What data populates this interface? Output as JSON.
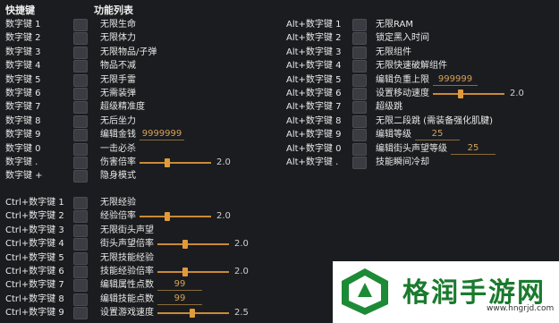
{
  "header": {
    "col_key": "快捷键",
    "col_func": "功能列表"
  },
  "left": [
    {
      "key": "数字键 1",
      "label": "无限生命"
    },
    {
      "key": "数字键 2",
      "label": "无限体力"
    },
    {
      "key": "数字键 3",
      "label": "无限物品/子弹"
    },
    {
      "key": "数字键 4",
      "label": "物品不减"
    },
    {
      "key": "数字键 5",
      "label": "无限手雷"
    },
    {
      "key": "数字键 6",
      "label": "无需装弹"
    },
    {
      "key": "数字键 7",
      "label": "超级精准度"
    },
    {
      "key": "数字键 8",
      "label": "无后坐力"
    },
    {
      "key": "数字键 9",
      "label": "编辑金钱",
      "input": "9999999"
    },
    {
      "key": "数字键 0",
      "label": "一击必杀"
    },
    {
      "key": "数字键 .",
      "label": "伤害倍率",
      "slider": "2.0",
      "level": 0.35
    },
    {
      "key": "数字键 +",
      "label": "隐身模式"
    }
  ],
  "left2": [
    {
      "key": "Ctrl+数字键 1",
      "label": "无限经验"
    },
    {
      "key": "Ctrl+数字键 2",
      "label": "经验倍率",
      "slider": "2.0",
      "level": 0.35
    },
    {
      "key": "Ctrl+数字键 3",
      "label": "无限街头声望"
    },
    {
      "key": "Ctrl+数字键 4",
      "label": "街头声望倍率",
      "slider": "2.0",
      "level": 0.35
    },
    {
      "key": "Ctrl+数字键 5",
      "label": "无限技能经验"
    },
    {
      "key": "Ctrl+数字键 6",
      "label": "技能经验倍率",
      "slider": "2.0",
      "level": 0.35
    },
    {
      "key": "Ctrl+数字键 7",
      "label": "编辑属性点数",
      "input": "99"
    },
    {
      "key": "Ctrl+数字键 8",
      "label": "编辑技能点数",
      "input": "99"
    },
    {
      "key": "Ctrl+数字键 9",
      "label": "设置游戏速度",
      "slider": "2.5",
      "level": 0.45
    }
  ],
  "right": [
    {
      "key": "Alt+数字键 1",
      "label": "无限RAM"
    },
    {
      "key": "Alt+数字键 2",
      "label": "锁定黑入时间"
    },
    {
      "key": "Alt+数字键 3",
      "label": "无限组件"
    },
    {
      "key": "Alt+数字键 4",
      "label": "无限快速破解组件"
    },
    {
      "key": "Alt+数字键 5",
      "label": "编辑负重上限",
      "input": "999999"
    },
    {
      "key": "Alt+数字键 6",
      "label": "设置移动速度",
      "slider": "2.0",
      "level": 0.35
    },
    {
      "key": "Alt+数字键 7",
      "label": "超级跳"
    },
    {
      "key": "Alt+数字键 8",
      "label": "无限二段跳 (需装备强化肌腱)"
    },
    {
      "key": "Alt+数字键 9",
      "label": "编辑等级",
      "input": "25"
    },
    {
      "key": "Alt+数字键 0",
      "label": "编辑街头声望等级",
      "input": "25"
    },
    {
      "key": "Alt+数字键 .",
      "label": "技能瞬间冷却"
    }
  ],
  "watermark": {
    "title": "格润手游网",
    "url": "www.hngrjd.com"
  }
}
